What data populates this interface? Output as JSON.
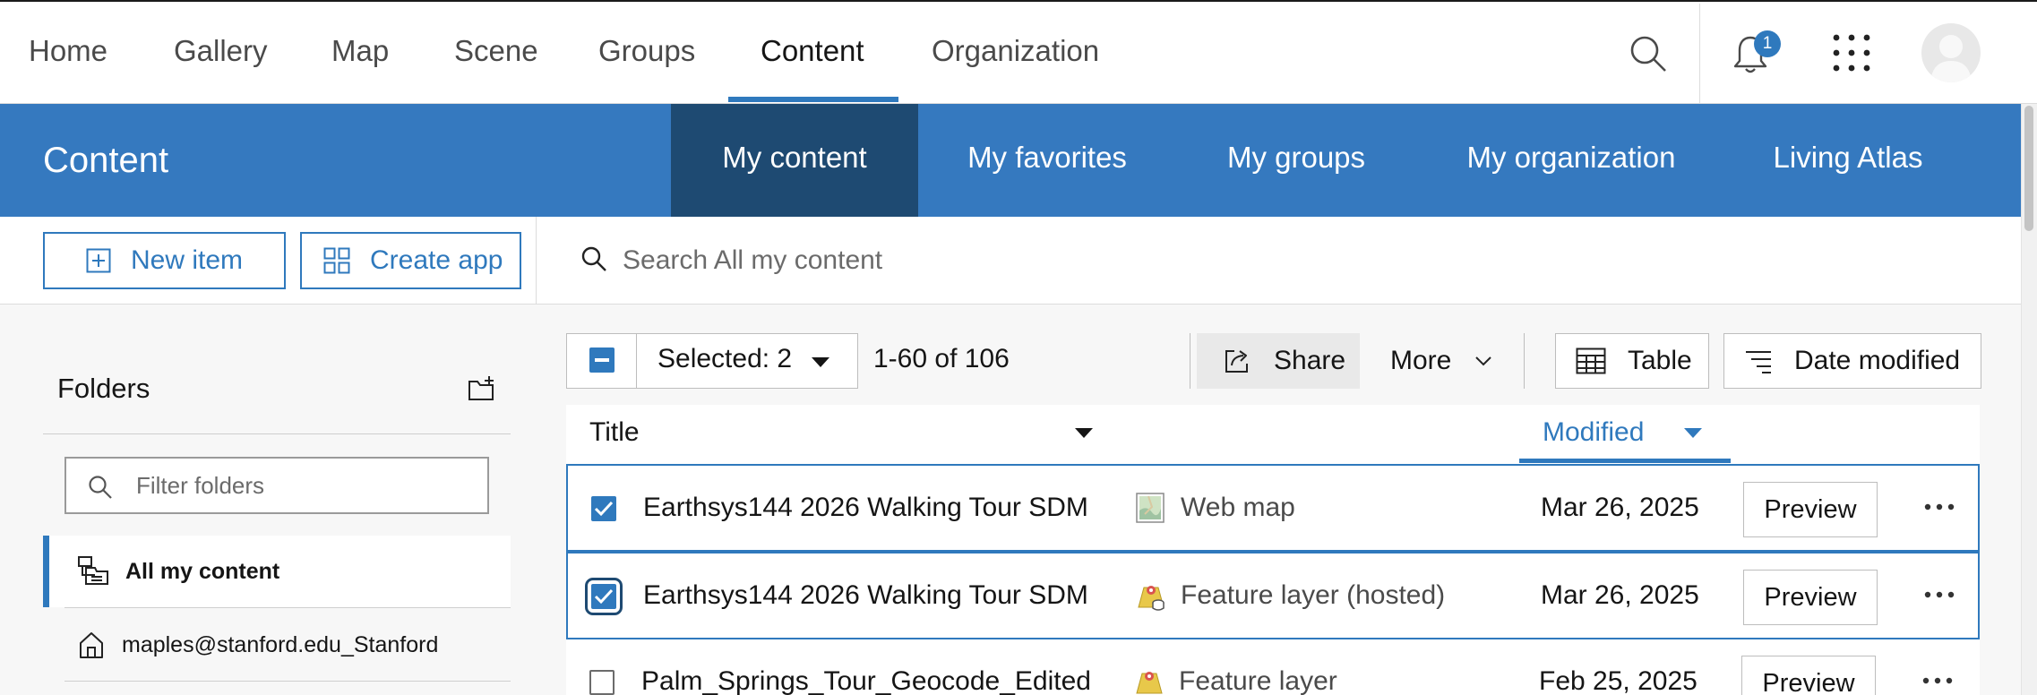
{
  "topnav": {
    "items": [
      "Home",
      "Gallery",
      "Map",
      "Scene",
      "Groups",
      "Content",
      "Organization"
    ],
    "active": "Content",
    "notification_count": "1"
  },
  "content_header": {
    "title": "Content",
    "tabs": [
      "My content",
      "My favorites",
      "My groups",
      "My organization",
      "Living Atlas"
    ],
    "active_tab": "My content"
  },
  "actions": {
    "new_item": "New item",
    "create_app": "Create app",
    "search_placeholder": "Search All my content"
  },
  "folders": {
    "title": "Folders",
    "filter_placeholder": "Filter folders",
    "items": [
      {
        "label": "All my content",
        "icon": "all-content-icon",
        "active": true
      },
      {
        "label": "maples@stanford.edu_Stanford",
        "icon": "home-icon",
        "active": false
      }
    ]
  },
  "toolbar": {
    "selected_label": "Selected: 2",
    "count_label": "1-60 of 106",
    "share": "Share",
    "more": "More",
    "view": "Table",
    "sort": "Date modified"
  },
  "table": {
    "columns": {
      "title": "Title",
      "modified": "Modified"
    },
    "rows": [
      {
        "title": "Earthsys144 2026 Walking Tour SDM",
        "type": "Web map",
        "type_icon": "web-map-icon",
        "modified": "Mar 26, 2025",
        "checked": true,
        "preview": "Preview"
      },
      {
        "title": "Earthsys144 2026 Walking Tour SDM",
        "type": "Feature layer (hosted)",
        "type_icon": "feature-layer-hosted-icon",
        "modified": "Mar 26, 2025",
        "checked": true,
        "preview": "Preview"
      },
      {
        "title": "Palm_Springs_Tour_Geocode_Edited",
        "type": "Feature layer",
        "type_icon": "feature-layer-icon",
        "modified": "Feb 25, 2025",
        "checked": false,
        "preview": "Preview"
      }
    ]
  },
  "colors": {
    "accent": "#2f79bd",
    "header_bg": "#3579bf",
    "active_tab_bg": "#1e4a72"
  }
}
